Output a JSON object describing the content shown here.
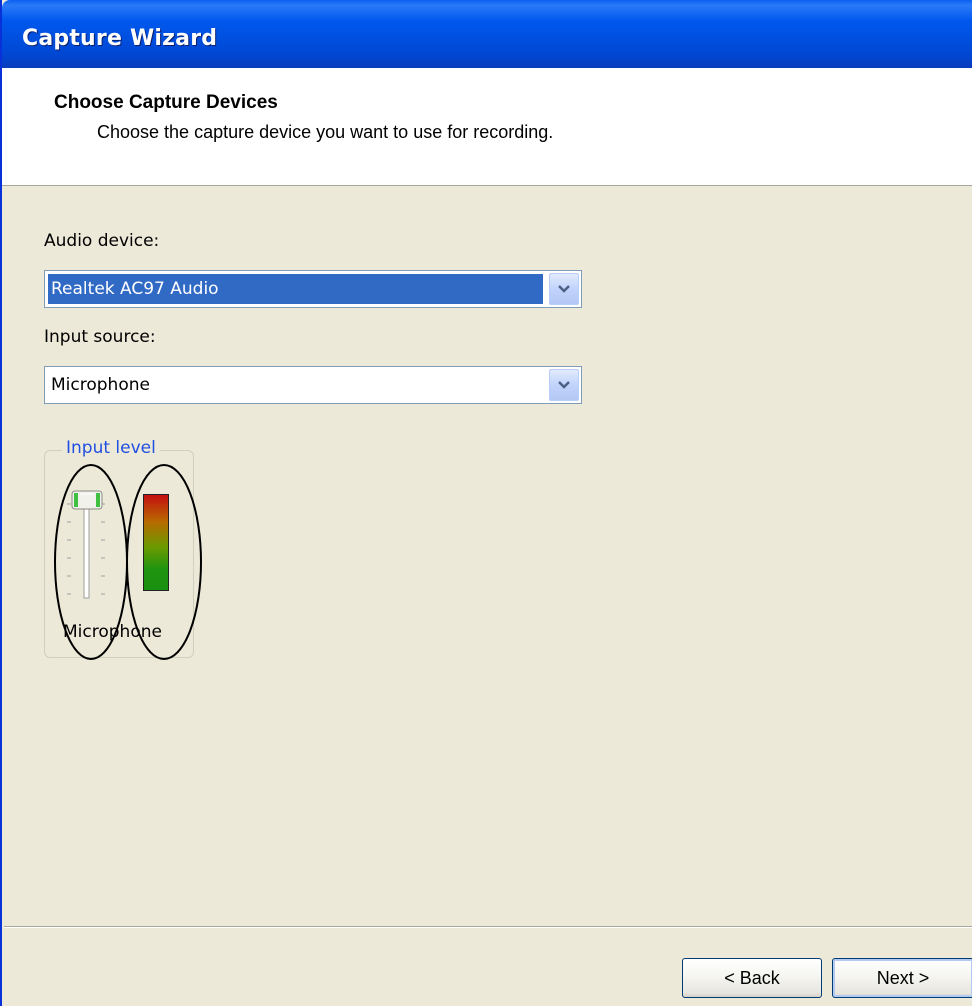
{
  "window": {
    "title": "Capture Wizard"
  },
  "header": {
    "title": "Choose Capture Devices",
    "subtitle": "Choose the capture device you want to use for recording."
  },
  "audio_device": {
    "label": "Audio device:",
    "value": "Realtek AC97 Audio"
  },
  "input_source": {
    "label": "Input source:",
    "value": "Microphone"
  },
  "input_level": {
    "group_label": "Input level",
    "slider_label": "Microphone",
    "slider_level": 1.0
  },
  "buttons": {
    "back": "< Back",
    "next": "Next >"
  },
  "colors": {
    "titlebar": "#0054e3",
    "selection": "#316ac5",
    "group_label": "#2050e0"
  }
}
